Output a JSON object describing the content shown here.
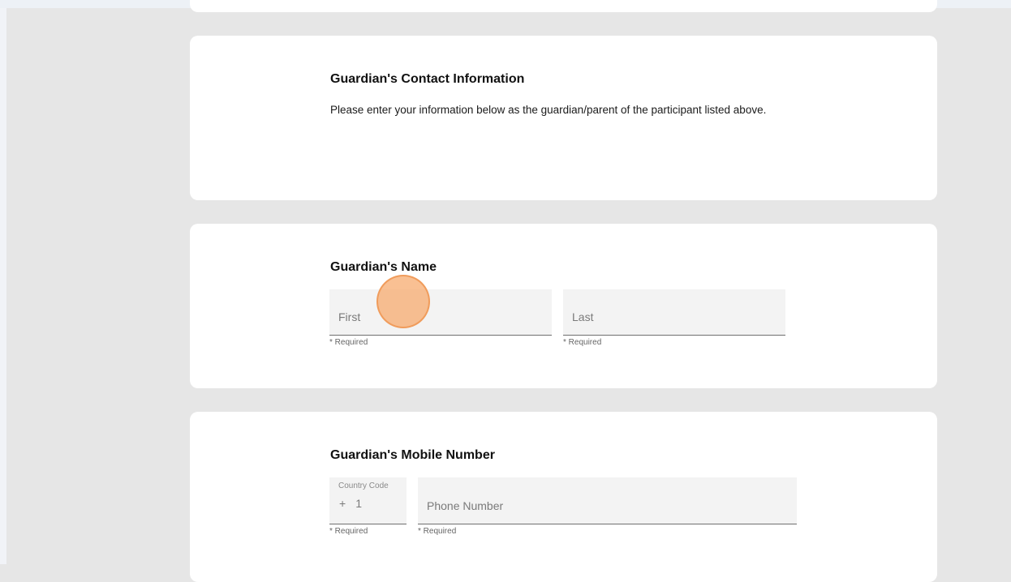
{
  "contact_section": {
    "title": "Guardian's Contact Information",
    "description": "Please enter your information below as the guardian/parent of the participant listed above."
  },
  "name_section": {
    "title": "Guardian's Name",
    "first": {
      "placeholder": "First",
      "value": "",
      "helper": "* Required"
    },
    "last": {
      "placeholder": "Last",
      "value": "",
      "helper": "* Required"
    }
  },
  "mobile_section": {
    "title": "Guardian's Mobile Number",
    "country_code": {
      "label": "Country Code",
      "prefix": "+",
      "value": "1",
      "helper": "* Required"
    },
    "phone": {
      "placeholder": "Phone Number",
      "value": "",
      "helper": "* Required"
    }
  },
  "colors": {
    "page_background": "#e6e6e6",
    "card_background": "#ffffff",
    "field_background": "#f3f3f3",
    "click_marker": "#f6a86a"
  },
  "click_marker": {
    "icon": "click-indicator-circle"
  }
}
